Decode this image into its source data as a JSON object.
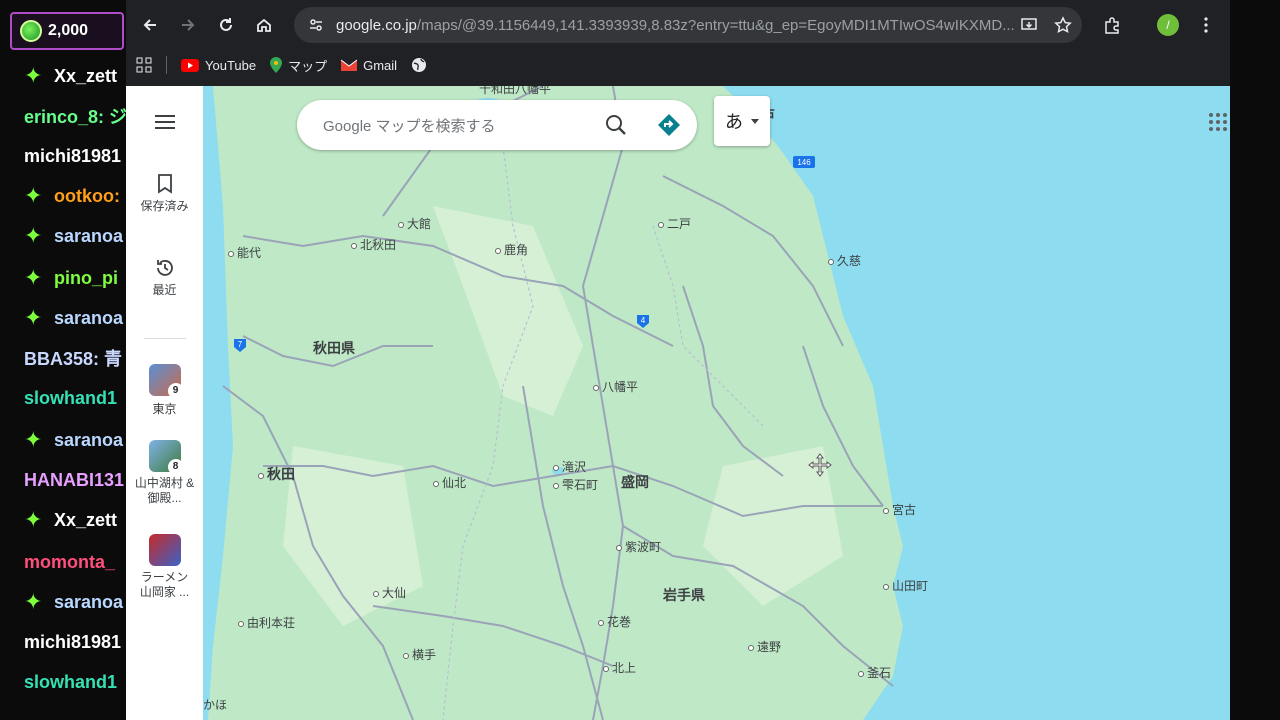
{
  "chat": {
    "coin_amount": "2,000",
    "lines": [
      {
        "text": "Xx_zett",
        "color": "#ffffff",
        "star": true
      },
      {
        "text": "erinco_8: ジ",
        "color": "#67ff8c",
        "star": false
      },
      {
        "text": "michi81981",
        "color": "#ffffff",
        "star": false
      },
      {
        "text": "ootkoo:",
        "color": "#ff9f1a",
        "star": true
      },
      {
        "text": "saranoa",
        "color": "#b9d7ff",
        "star": true
      },
      {
        "text": "pino_pi",
        "color": "#7dff3e",
        "star": true
      },
      {
        "text": "saranoa",
        "color": "#b9d7ff",
        "star": true
      },
      {
        "text": "BBA358: 青",
        "color": "#c9d8ff",
        "star": false
      },
      {
        "text": "slowhand1",
        "color": "#36e0b5",
        "star": false
      },
      {
        "text": "saranoa",
        "color": "#b9d7ff",
        "star": true
      },
      {
        "text": "HANABI131",
        "color": "#e7a0ff",
        "star": false
      },
      {
        "text": "Xx_zett",
        "color": "#ffffff",
        "star": true
      },
      {
        "text": "momonta_",
        "color": "#ff4f7b",
        "star": false
      },
      {
        "text": "saranoa",
        "color": "#b9d7ff",
        "star": true
      },
      {
        "text": "michi81981",
        "color": "#ffffff",
        "star": false
      },
      {
        "text": "slowhand1",
        "color": "#36e0b5",
        "star": false
      }
    ]
  },
  "browser": {
    "url_domain": "google.co.jp",
    "url_rest": "/maps/@39.1156449,141.3393939,8.83z?entry=ttu&g_ep=EgoyMDI1MTIwOS4wIKXMD...",
    "bookmarks": [
      {
        "label": "YouTube",
        "icon": "youtube-icon"
      },
      {
        "label": "マップ",
        "icon": "maps-icon"
      },
      {
        "label": "Gmail",
        "icon": "gmail-icon"
      }
    ]
  },
  "maps": {
    "search_placeholder": "Google マップを検索する",
    "lang_label": "あ",
    "avatar_letter": "/",
    "rail": {
      "saved_label": "保存済み",
      "recent_label": "最近",
      "lists": [
        {
          "label": "東京",
          "count": "9"
        },
        {
          "label": "山中湖村 & 御殿...",
          "count": "8"
        },
        {
          "label": "ラーメン 山岡家 ...",
          "count": ""
        }
      ]
    },
    "places": [
      {
        "name": "十和田八幡平",
        "big": false,
        "dot": false
      },
      {
        "name": "八戸",
        "big": true,
        "dot": true
      },
      {
        "name": "大館",
        "big": false,
        "dot": true
      },
      {
        "name": "二戸",
        "big": false,
        "dot": true
      },
      {
        "name": "能代",
        "big": false,
        "dot": true
      },
      {
        "name": "北秋田",
        "big": false,
        "dot": true
      },
      {
        "name": "鹿角",
        "big": false,
        "dot": true
      },
      {
        "name": "久慈",
        "big": false,
        "dot": true
      },
      {
        "name": "秋田県",
        "big": true,
        "dot": false
      },
      {
        "name": "八幡平",
        "big": false,
        "dot": true
      },
      {
        "name": "秋田",
        "big": true,
        "dot": true
      },
      {
        "name": "滝沢",
        "big": false,
        "dot": true
      },
      {
        "name": "仙北",
        "big": false,
        "dot": true
      },
      {
        "name": "雫石町",
        "big": false,
        "dot": true
      },
      {
        "name": "盛岡",
        "big": true,
        "dot": false
      },
      {
        "name": "宮古",
        "big": false,
        "dot": true
      },
      {
        "name": "紫波町",
        "big": false,
        "dot": true
      },
      {
        "name": "山田町",
        "big": false,
        "dot": true
      },
      {
        "name": "大仙",
        "big": false,
        "dot": true
      },
      {
        "name": "岩手県",
        "big": true,
        "dot": false
      },
      {
        "name": "由利本荘",
        "big": false,
        "dot": true
      },
      {
        "name": "花巻",
        "big": false,
        "dot": true
      },
      {
        "name": "遠野",
        "big": false,
        "dot": true
      },
      {
        "name": "横手",
        "big": false,
        "dot": true
      },
      {
        "name": "北上",
        "big": false,
        "dot": true
      },
      {
        "name": "釜石",
        "big": false,
        "dot": true
      },
      {
        "name": "かほ",
        "big": false,
        "dot": false
      }
    ],
    "road_shields": [
      "146",
      "4",
      "7"
    ],
    "colors": {
      "land": "#bfe9c6",
      "sea": "#8ddcf0",
      "road": "#9aa0b5"
    }
  }
}
